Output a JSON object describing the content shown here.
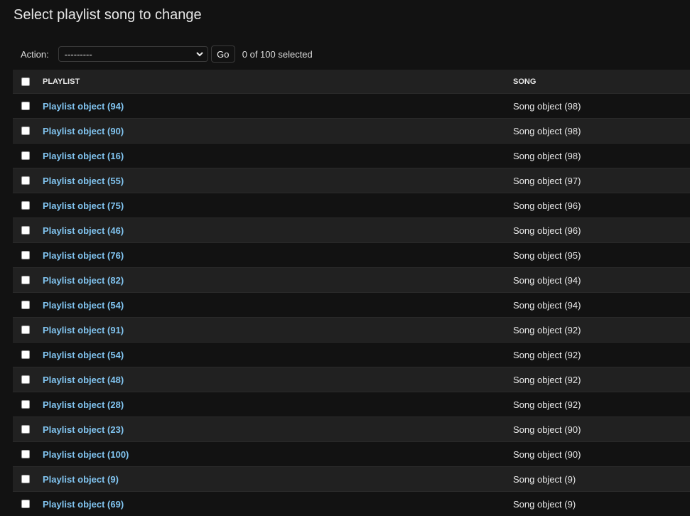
{
  "page_title": "Select playlist song to change",
  "actions": {
    "label": "Action:",
    "selected": "---------",
    "go_label": "Go",
    "counter": "0 of 100 selected"
  },
  "columns": {
    "playlist": "PLAYLIST",
    "song": "SONG"
  },
  "colors": {
    "background": "#121212",
    "row_alt": "#212121",
    "link": "#81c4f0"
  },
  "rows": [
    {
      "playlist": "Playlist object (94)",
      "song": "Song object (98)"
    },
    {
      "playlist": "Playlist object (90)",
      "song": "Song object (98)"
    },
    {
      "playlist": "Playlist object (16)",
      "song": "Song object (98)"
    },
    {
      "playlist": "Playlist object (55)",
      "song": "Song object (97)"
    },
    {
      "playlist": "Playlist object (75)",
      "song": "Song object (96)"
    },
    {
      "playlist": "Playlist object (46)",
      "song": "Song object (96)"
    },
    {
      "playlist": "Playlist object (76)",
      "song": "Song object (95)"
    },
    {
      "playlist": "Playlist object (82)",
      "song": "Song object (94)"
    },
    {
      "playlist": "Playlist object (54)",
      "song": "Song object (94)"
    },
    {
      "playlist": "Playlist object (91)",
      "song": "Song object (92)"
    },
    {
      "playlist": "Playlist object (54)",
      "song": "Song object (92)"
    },
    {
      "playlist": "Playlist object (48)",
      "song": "Song object (92)"
    },
    {
      "playlist": "Playlist object (28)",
      "song": "Song object (92)"
    },
    {
      "playlist": "Playlist object (23)",
      "song": "Song object (90)"
    },
    {
      "playlist": "Playlist object (100)",
      "song": "Song object (90)"
    },
    {
      "playlist": "Playlist object (9)",
      "song": "Song object (9)"
    },
    {
      "playlist": "Playlist object (69)",
      "song": "Song object (9)"
    }
  ]
}
